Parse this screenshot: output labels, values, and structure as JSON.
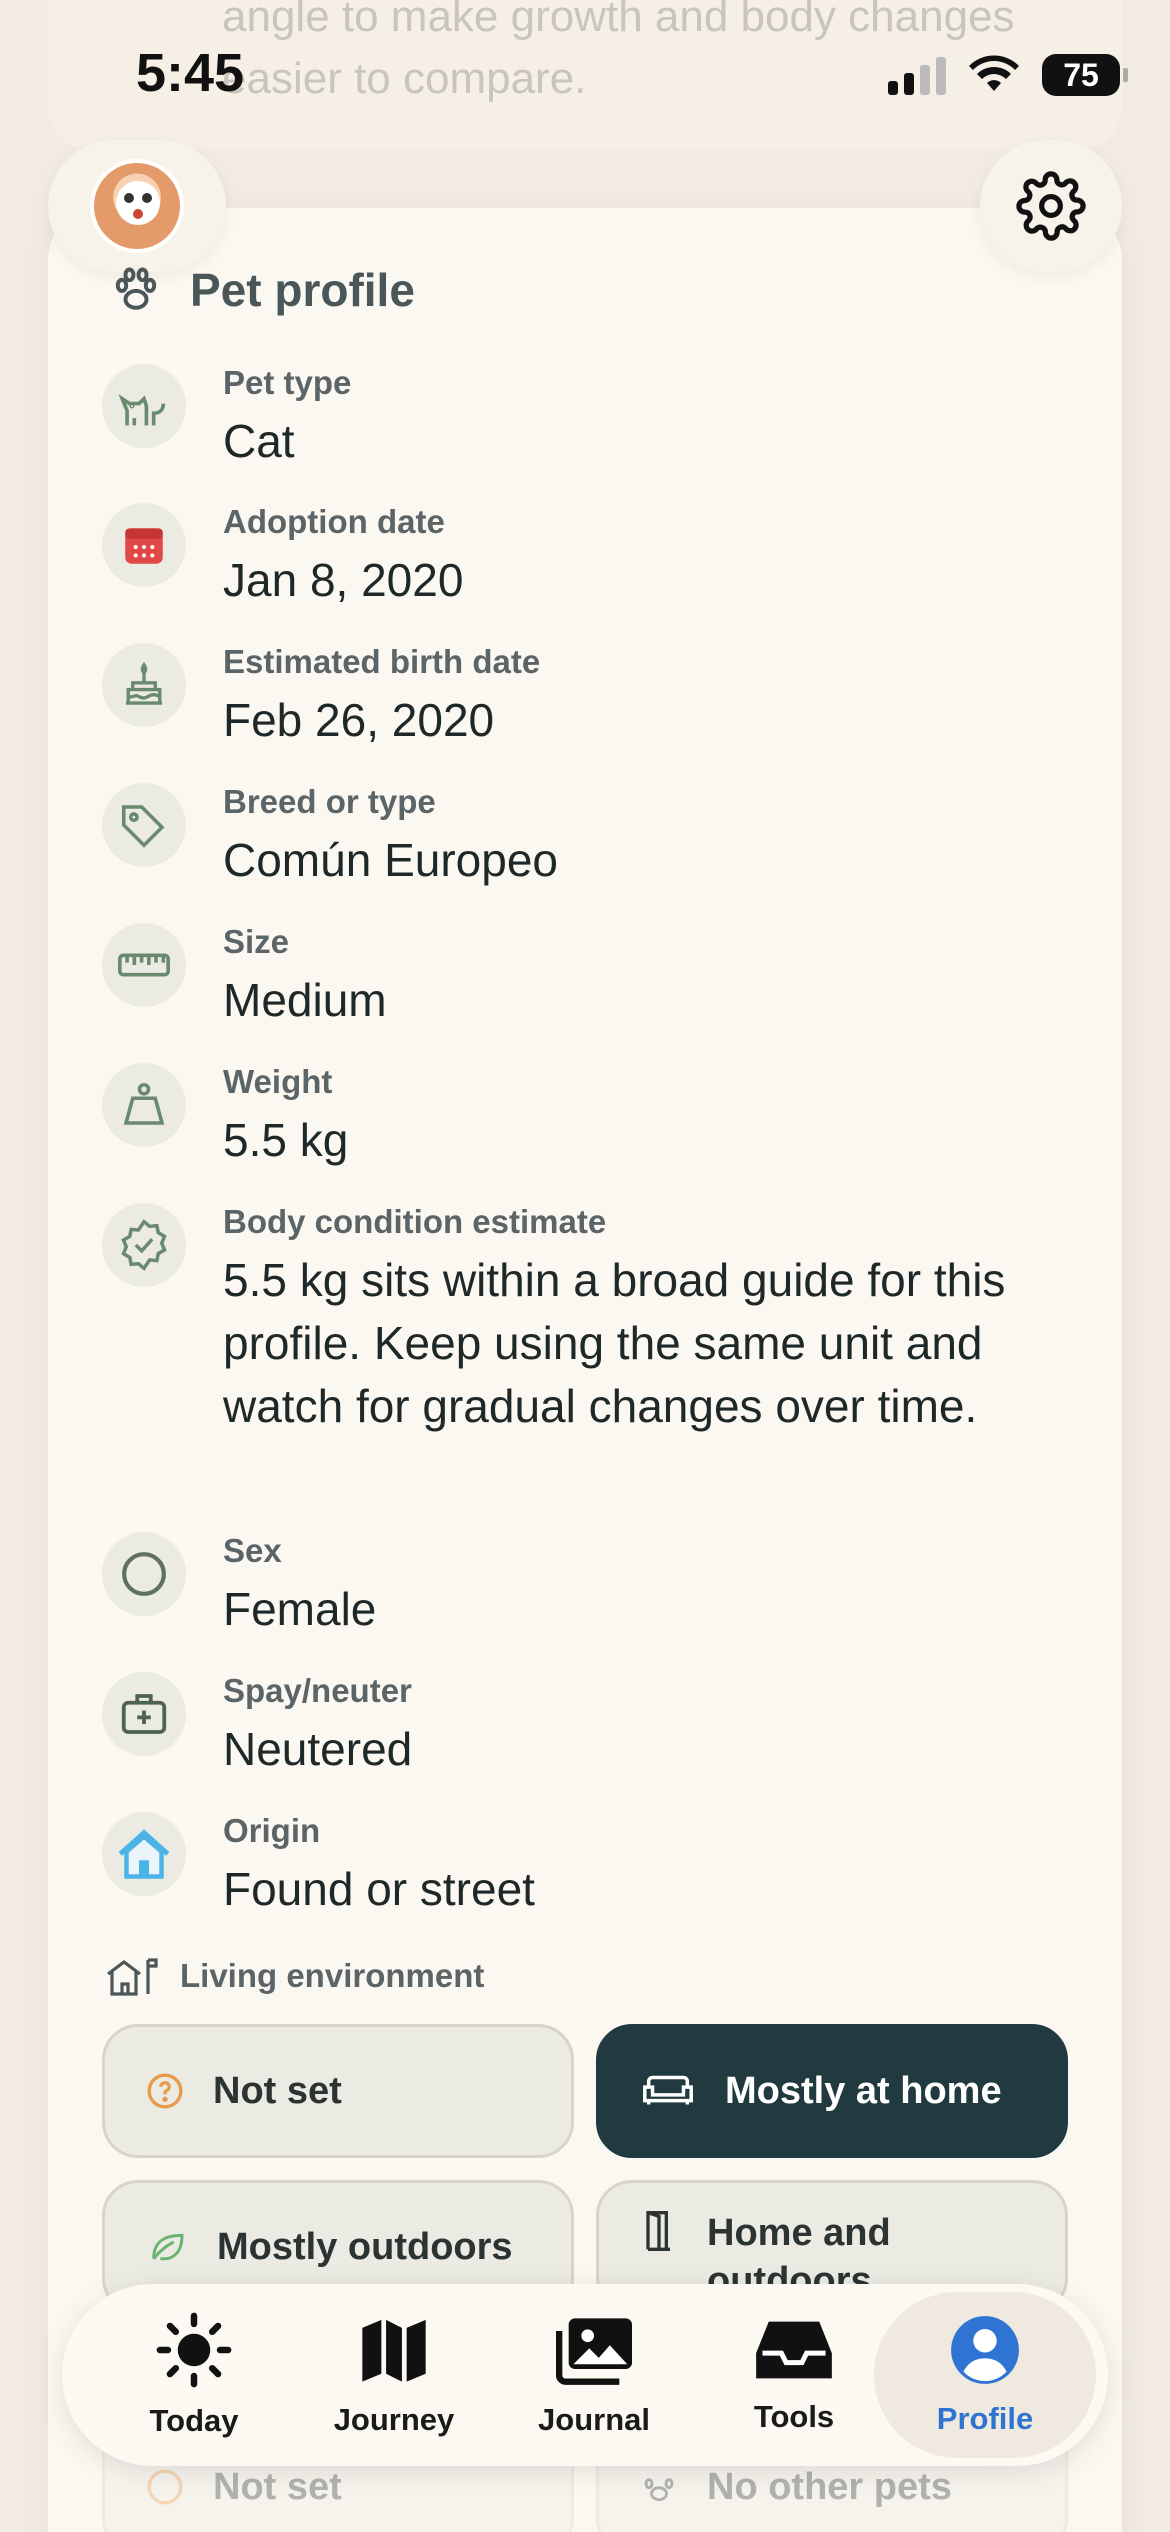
{
  "background_text": "angle to make growth and body changes easier to compare.",
  "status_bar": {
    "time": "5:45",
    "battery": "75"
  },
  "profile_card": {
    "title": "Pet profile",
    "fields": [
      {
        "label": "Pet type",
        "value": "Cat",
        "icon": "cat-icon"
      },
      {
        "label": "Adoption date",
        "value": "Jan 8, 2020",
        "icon": "calendar-icon"
      },
      {
        "label": "Estimated birth date",
        "value": "Feb 26, 2020",
        "icon": "cake-icon"
      },
      {
        "label": "Breed or type",
        "value": "Común Europeo",
        "icon": "tag-icon"
      },
      {
        "label": "Size",
        "value": "Medium",
        "icon": "ruler-icon"
      },
      {
        "label": "Weight",
        "value": "5.5 kg",
        "icon": "weight-icon"
      },
      {
        "label": "Body condition estimate",
        "value": "5.5 kg sits within a broad guide for this profile. Keep using the same unit and watch for gradual changes over time.",
        "icon": "badge-check-icon"
      },
      {
        "label": "Sex",
        "value": "Female",
        "icon": "circle-icon"
      },
      {
        "label": "Spay/neuter",
        "value": "Neutered",
        "icon": "medical-kit-icon"
      },
      {
        "label": "Origin",
        "value": "Found or street",
        "icon": "house-icon"
      }
    ],
    "living_environment": {
      "label": "Living environment",
      "options": [
        {
          "label": "Not set",
          "icon": "question-icon",
          "selected": false
        },
        {
          "label": "Mostly at home",
          "icon": "sofa-icon",
          "selected": true
        },
        {
          "label": "Mostly outdoors",
          "icon": "leaf-icon",
          "selected": false
        },
        {
          "label": "Home and outdoors",
          "icon": "door-icon",
          "selected": false
        }
      ]
    },
    "other_pets_faded": {
      "label_1": "Not set",
      "label_2": "No other pets"
    }
  },
  "nav": {
    "items": [
      {
        "label": "Today",
        "icon": "sun-icon"
      },
      {
        "label": "Journey",
        "icon": "map-icon"
      },
      {
        "label": "Journal",
        "icon": "photos-icon"
      },
      {
        "label": "Tools",
        "icon": "tray-icon"
      },
      {
        "label": "Profile",
        "icon": "person-icon"
      }
    ],
    "active": "Profile"
  },
  "colors": {
    "accent": "#2f74d2",
    "selected_chip": "#213a40",
    "background": "#f1ebe1",
    "card": "#fbf8f2"
  }
}
